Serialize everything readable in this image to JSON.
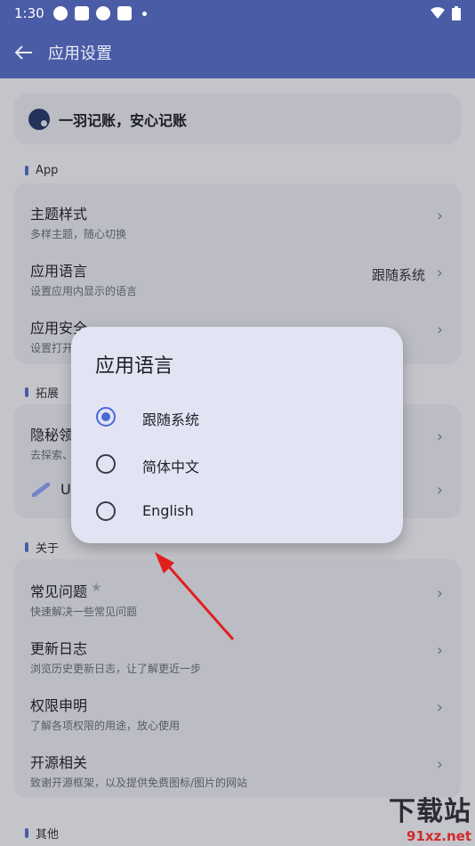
{
  "status": {
    "time": "1:30"
  },
  "appbar": {
    "title": "应用设置"
  },
  "slogan": "一羽记账，安心记账",
  "sections": {
    "app": "App",
    "ext": "拓展",
    "about": "关于",
    "other": "其他"
  },
  "app_rows": [
    {
      "title": "主题样式",
      "subtitle": "多样主题，随心切换",
      "value": ""
    },
    {
      "title": "应用语言",
      "subtitle": "设置应用内显示的语言",
      "value": "跟随系统"
    },
    {
      "title": "应用安全",
      "subtitle": "设置打开",
      "value": ""
    }
  ],
  "ext_rows": [
    {
      "title": "隐秘领",
      "subtitle": "去探索、"
    },
    {
      "title": "U"
    }
  ],
  "about_rows": [
    {
      "title": "常见问题",
      "subtitle": "快速解决一些常见问题"
    },
    {
      "title": "更新日志",
      "subtitle": "浏览历史更新日志，让了解更近一步"
    },
    {
      "title": "权限申明",
      "subtitle": "了解各项权限的用途，放心使用"
    },
    {
      "title": "开源相关",
      "subtitle": "致谢开源框架，以及提供免费图标/图片的网站"
    }
  ],
  "dialog": {
    "title": "应用语言",
    "options": [
      "跟随系统",
      "简体中文",
      "English"
    ],
    "selected": 0
  },
  "watermark": {
    "big": "下载站",
    "small": "91xz.net"
  },
  "colors": {
    "accent": "#4a5ca6",
    "radio": "#4a68d8",
    "arrow": "#e02020"
  }
}
